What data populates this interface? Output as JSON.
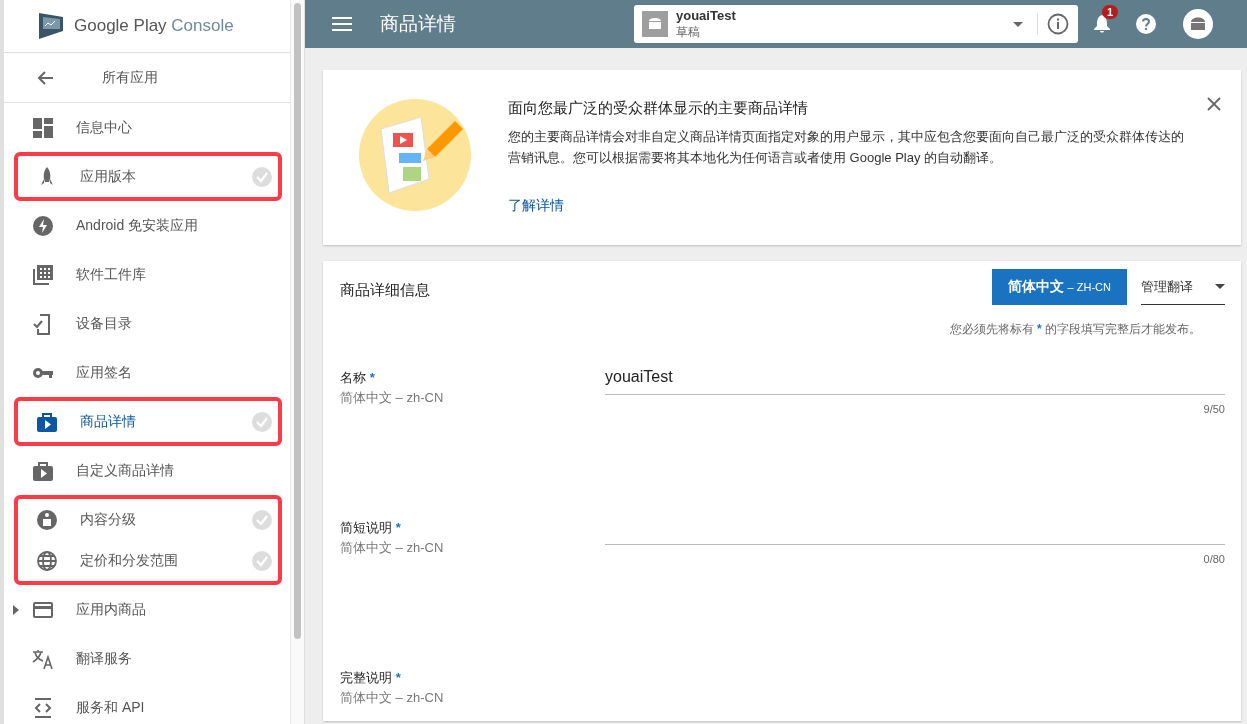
{
  "sidebar": {
    "logo": {
      "brand": "Google Play",
      "product": "Console"
    },
    "back": {
      "label": "所有应用"
    },
    "items": [
      {
        "label": "信息中心",
        "selected": false,
        "completed": false,
        "expandable": false,
        "highlighted": false
      },
      {
        "label": "应用版本",
        "selected": false,
        "completed": true,
        "expandable": false,
        "highlighted": true
      },
      {
        "label": "Android 免安装应用",
        "selected": false,
        "completed": false,
        "expandable": false,
        "highlighted": false
      },
      {
        "label": "软件工件库",
        "selected": false,
        "completed": false,
        "expandable": false,
        "highlighted": false
      },
      {
        "label": "设备目录",
        "selected": false,
        "completed": false,
        "expandable": false,
        "highlighted": false
      },
      {
        "label": "应用签名",
        "selected": false,
        "completed": false,
        "expandable": false,
        "highlighted": false
      },
      {
        "label": "商品详情",
        "selected": true,
        "completed": true,
        "expandable": false,
        "highlighted": true
      },
      {
        "label": "自定义商品详情",
        "selected": false,
        "completed": false,
        "expandable": false,
        "highlighted": false
      },
      {
        "label": "内容分级",
        "selected": false,
        "completed": true,
        "expandable": false,
        "highlighted": true
      },
      {
        "label": "定价和分发范围",
        "selected": false,
        "completed": true,
        "expandable": false,
        "highlighted": true
      },
      {
        "label": "应用内商品",
        "selected": false,
        "completed": false,
        "expandable": true,
        "highlighted": false
      },
      {
        "label": "翻译服务",
        "selected": false,
        "completed": false,
        "expandable": false,
        "highlighted": false
      },
      {
        "label": "服务和 API",
        "selected": false,
        "completed": false,
        "expandable": false,
        "highlighted": false
      }
    ]
  },
  "header": {
    "title": "商品详情",
    "app_selector": {
      "name": "youaiTest",
      "status": "草稿"
    },
    "notifications": {
      "count": "1"
    }
  },
  "banner": {
    "title": "面向您最广泛的受众群体显示的主要商品详情",
    "body": "您的主要商品详情会对非自定义商品详情页面指定对象的用户显示，其中应包含您要面向自己最广泛的受众群体传达的营销讯息。您可以根据需要将其本地化为任何语言或者使用 Google Play 的自动翻译。",
    "link": "了解详情"
  },
  "details": {
    "title": "商品详细信息",
    "language_button": {
      "label": "简体中文",
      "code": "– ZH-CN"
    },
    "translate_menu": "管理翻译",
    "note": {
      "before": "您必须先将标有",
      "marker": "*",
      "after": "的字段填写完整后才能发布。"
    },
    "fields": [
      {
        "label": "名称",
        "marker": "*",
        "language": "简体中文 – zh-CN",
        "value": "youaiTest",
        "counter": "9/50"
      },
      {
        "label": "简短说明",
        "marker": "*",
        "language": "简体中文 – zh-CN",
        "counter": "0/80"
      },
      {
        "label": "完整说明",
        "marker": "*",
        "language": "简体中文 – zh-CN"
      }
    ]
  }
}
